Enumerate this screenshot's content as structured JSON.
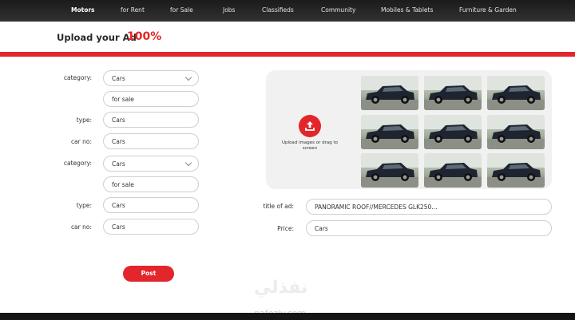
{
  "nav": {
    "items": [
      {
        "label": "Motors",
        "active": true
      },
      {
        "label": "for Rent",
        "active": false
      },
      {
        "label": "for Sale",
        "active": false
      },
      {
        "label": "Jobs",
        "active": false
      },
      {
        "label": "Classifieds",
        "active": false
      },
      {
        "label": "Community",
        "active": false
      },
      {
        "label": "Mobiles & Tablets",
        "active": false
      },
      {
        "label": "Furniture & Garden",
        "active": false
      }
    ]
  },
  "header": {
    "title": "Upload your Ad",
    "progress_text": "100%",
    "progress": 1.0
  },
  "form": {
    "group1": {
      "category_label": "category:",
      "category_value": "Cars",
      "subcategory_value": "for sale",
      "type_label": "type:",
      "type_value": "Cars",
      "carno_label": "car no:",
      "carno_value": "Cars"
    },
    "group2": {
      "category_label": "category:",
      "category_value": "Cars",
      "subcategory_value": "for sale",
      "type_label": "type:",
      "type_value": "Cars",
      "carno_label": "car no:",
      "carno_value": "Cars"
    },
    "title_label": "title of ad:",
    "title_value": "PANORAMIC ROOF//MERCEDES GLK250...",
    "price_label": "Price:",
    "price_value": "Cars",
    "post_label": "Post"
  },
  "upload": {
    "text": "Upload images or drag to screen",
    "icon": "upload-icon",
    "thumbnails": [
      "car-photo",
      "car-photo",
      "car-photo",
      "car-photo",
      "car-photo",
      "car-photo",
      "car-photo",
      "car-photo",
      "car-photo"
    ]
  },
  "watermark": {
    "arabic": "نفذلي",
    "latin": "nafezly.com"
  },
  "colors": {
    "accent": "#e3262b",
    "nav_bg": "#262626",
    "field_border": "#cfcfcf",
    "upload_bg": "#f1f1f1"
  }
}
